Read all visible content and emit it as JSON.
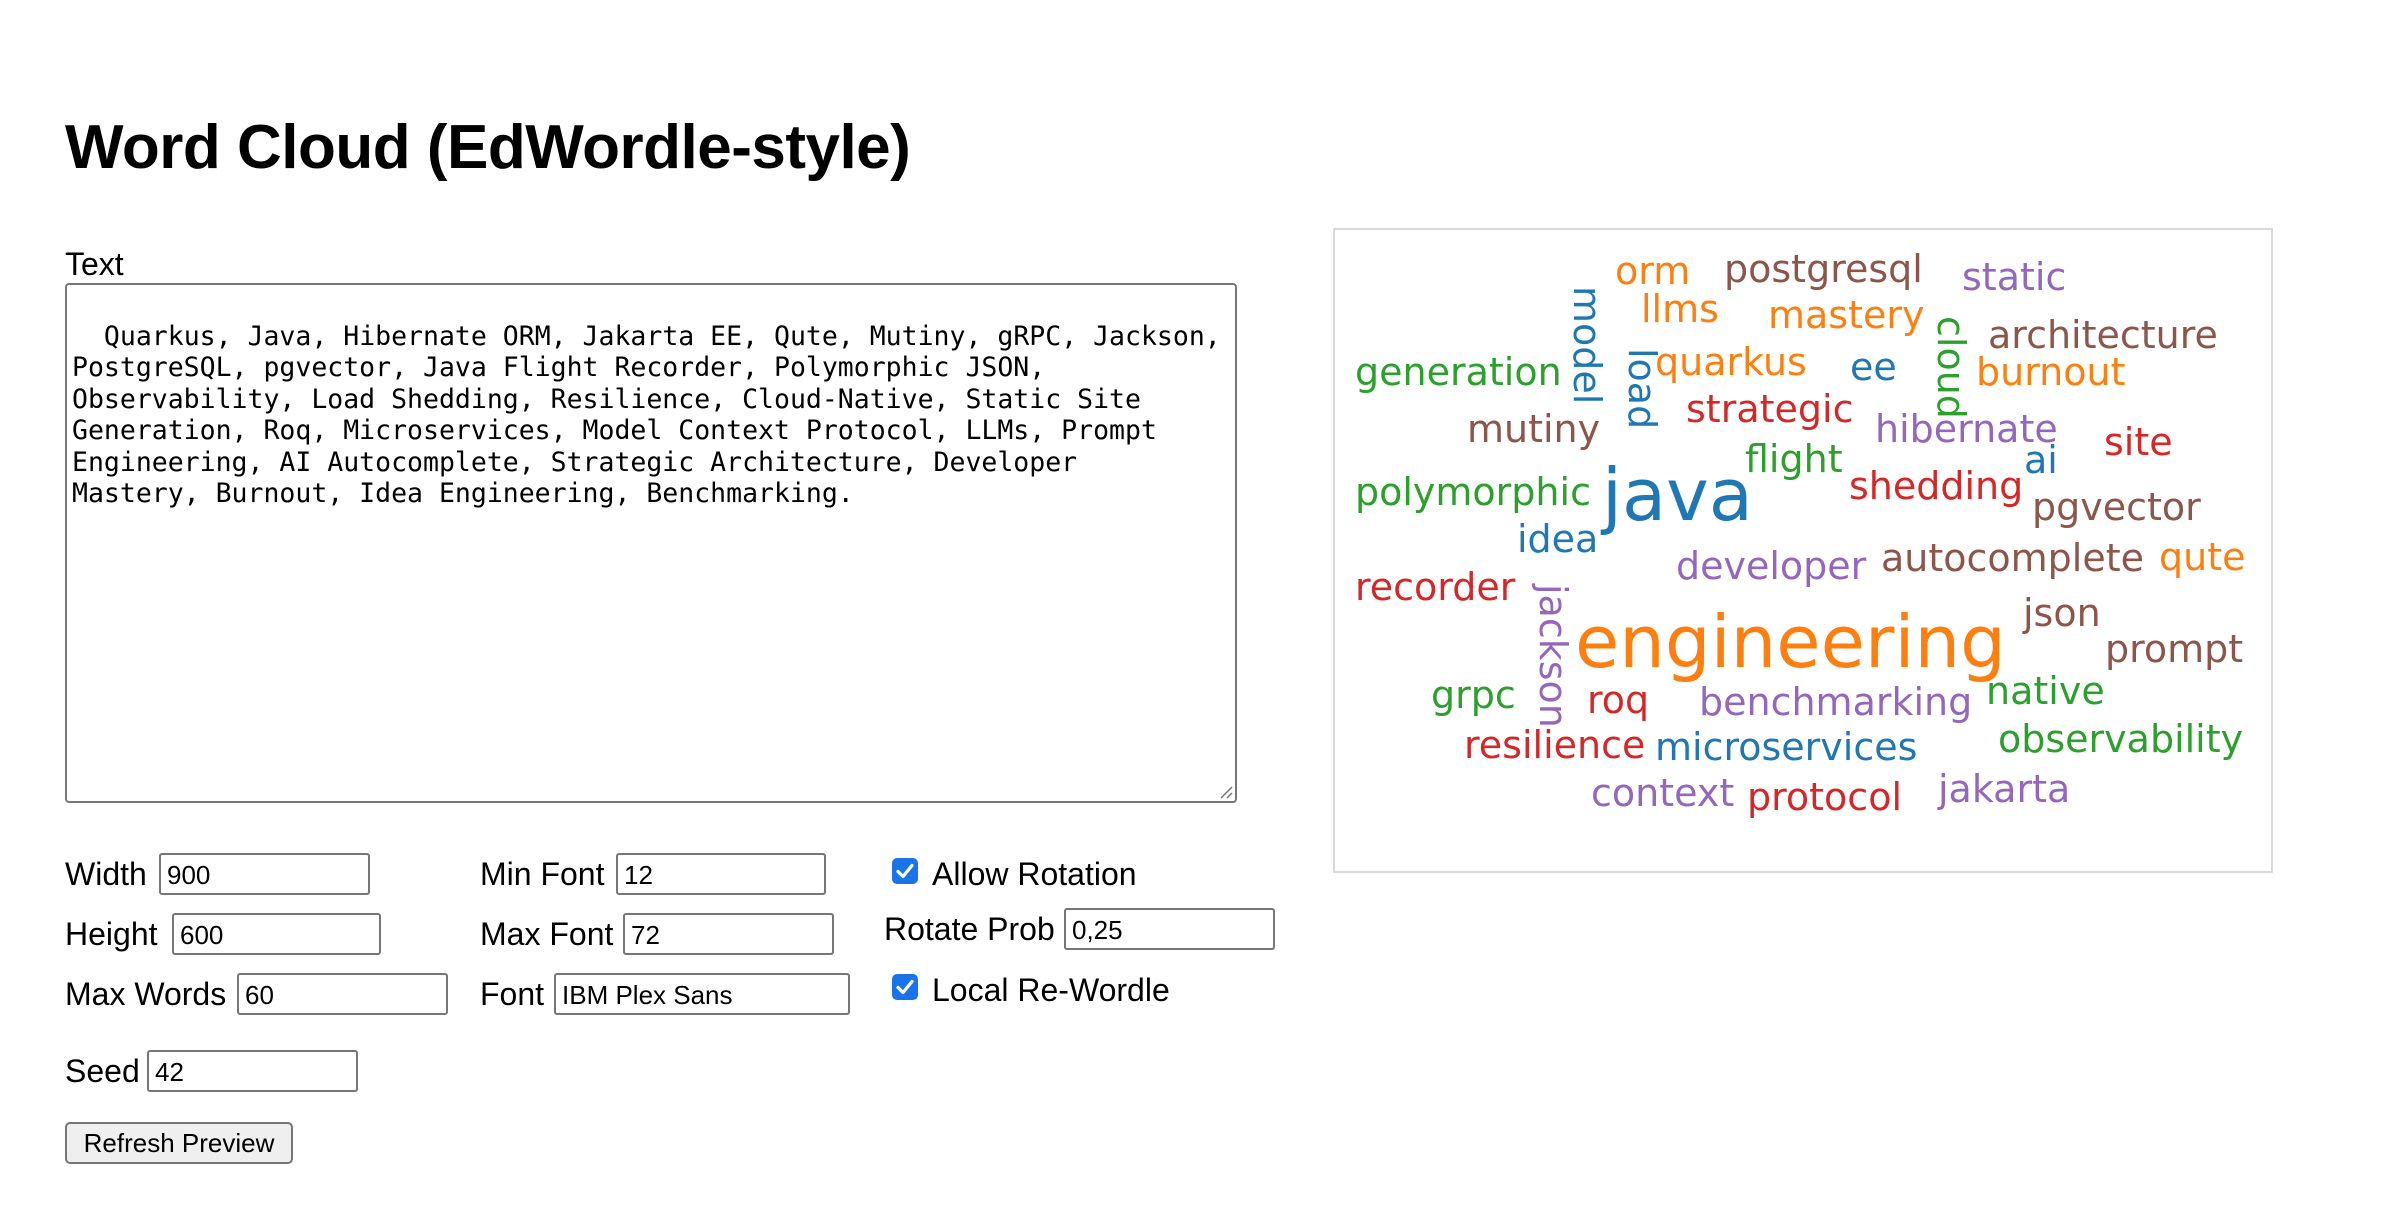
{
  "page": {
    "title": "Word Cloud (EdWordle-style)"
  },
  "editor": {
    "label": "Text",
    "value": "Quarkus, Java, Hibernate ORM, Jakarta EE, Qute, Mutiny, gRPC, Jackson,\nPostgreSQL, pgvector, Java Flight Recorder, Polymorphic JSON,\nObservability, Load Shedding, Resilience, Cloud-Native, Static Site\nGeneration, Roq, Microservices, Model Context Protocol, LLMs, Prompt\nEngineering, AI Autocomplete, Strategic Architecture, Developer\nMastery, Burnout, Idea Engineering, Benchmarking."
  },
  "settings": {
    "width": {
      "label": "Width",
      "value": "900"
    },
    "height": {
      "label": "Height",
      "value": "600"
    },
    "max_words": {
      "label": "Max Words",
      "value": "60"
    },
    "min_font": {
      "label": "Min Font",
      "value": "12"
    },
    "max_font": {
      "label": "Max Font",
      "value": "72"
    },
    "font": {
      "label": "Font",
      "value": "IBM Plex Sans"
    },
    "allow_rotation": {
      "label": "Allow Rotation",
      "checked": true
    },
    "rotate_prob": {
      "label": "Rotate Prob",
      "value": "0,25"
    },
    "local_rewordle": {
      "label": "Local Re-Wordle",
      "checked": true
    },
    "seed": {
      "label": "Seed",
      "value": "42"
    }
  },
  "actions": {
    "refresh_label": "Refresh Preview"
  },
  "cloud": {
    "colors": {
      "blue": "#1f77b4",
      "orange": "#ff7f0e",
      "green": "#2ca02c",
      "red": "#d62728",
      "purple": "#9467bd",
      "brown": "#8c564b"
    },
    "words": [
      "orm",
      "postgresql",
      "static",
      "model",
      "llms",
      "mastery",
      "cloud",
      "architecture",
      "load",
      "quarkus",
      "ee",
      "generation",
      "burnout",
      "strategic",
      "mutiny",
      "hibernate",
      "flight",
      "ai",
      "site",
      "polymorphic",
      "java",
      "shedding",
      "pgvector",
      "idea",
      "developer",
      "autocomplete",
      "qute",
      "recorder",
      "jackson",
      "json",
      "engineering",
      "prompt",
      "grpc",
      "roq",
      "benchmarking",
      "native",
      "observability",
      "resilience",
      "microservices",
      "context",
      "protocol",
      "jakarta"
    ]
  }
}
